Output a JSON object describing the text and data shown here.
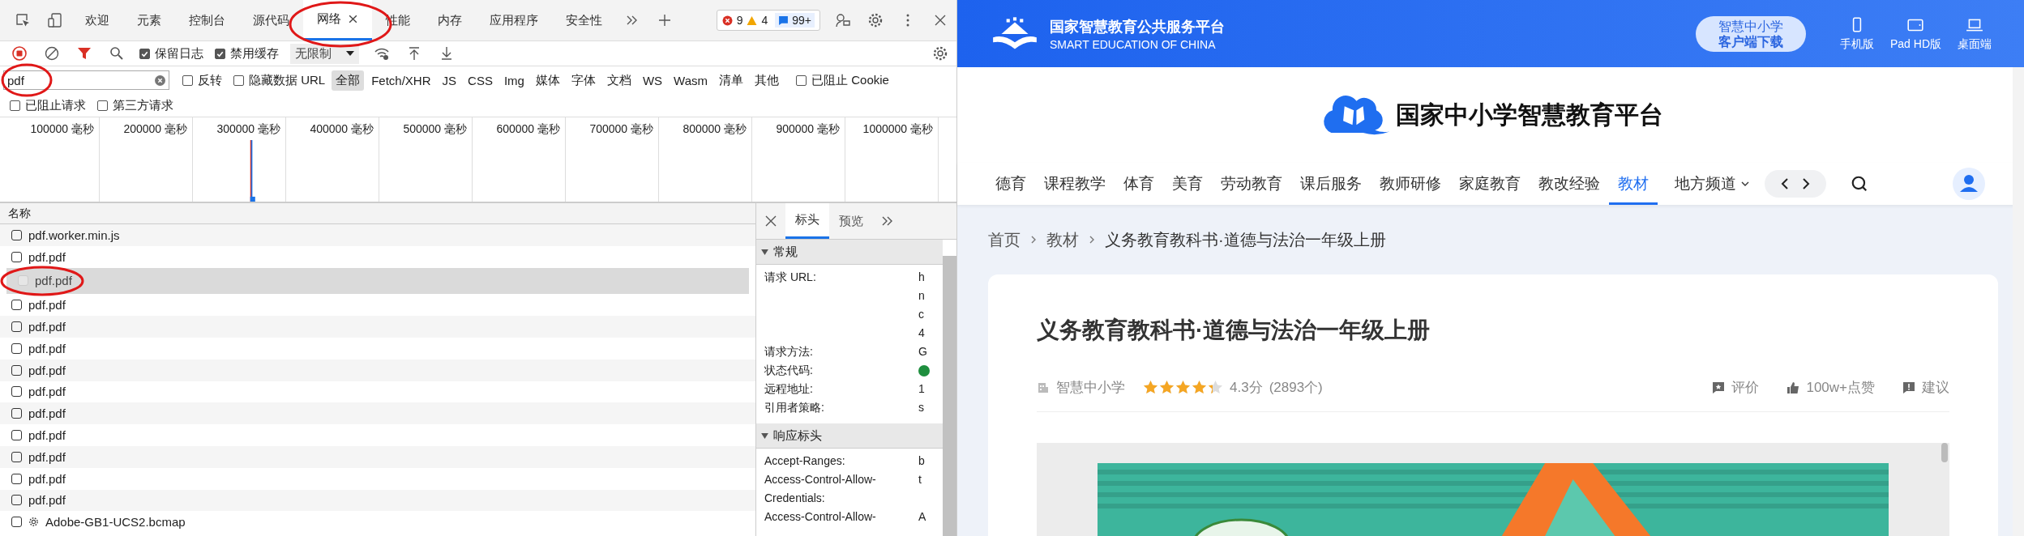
{
  "devtools": {
    "tabs": [
      {
        "label": "欢迎",
        "selected": false,
        "closable": false
      },
      {
        "label": "元素",
        "selected": false,
        "closable": false
      },
      {
        "label": "控制台",
        "selected": false,
        "closable": false
      },
      {
        "label": "源代码",
        "selected": false,
        "closable": false
      },
      {
        "label": "网络",
        "selected": true,
        "closable": true
      },
      {
        "label": "性能",
        "selected": false,
        "closable": false
      },
      {
        "label": "内存",
        "selected": false,
        "closable": false
      },
      {
        "label": "应用程序",
        "selected": false,
        "closable": false
      },
      {
        "label": "安全性",
        "selected": false,
        "closable": false
      }
    ],
    "issues": {
      "errors": "9",
      "warnings": "4",
      "messages": "99+"
    },
    "toolbar": {
      "preserve_log": {
        "label": "保留日志",
        "checked": true
      },
      "disable_cache": {
        "label": "禁用缓存",
        "checked": true
      },
      "throttling": "无限制"
    },
    "filter": {
      "value": "pdf",
      "options": [
        {
          "label": "反转",
          "checked": false
        },
        {
          "label": "隐藏数据 URL",
          "checked": false
        }
      ],
      "types": [
        {
          "label": "全部",
          "selected": true
        },
        {
          "label": "Fetch/XHR",
          "selected": false
        },
        {
          "label": "JS",
          "selected": false
        },
        {
          "label": "CSS",
          "selected": false
        },
        {
          "label": "Img",
          "selected": false
        },
        {
          "label": "媒体",
          "selected": false
        },
        {
          "label": "字体",
          "selected": false
        },
        {
          "label": "文档",
          "selected": false
        },
        {
          "label": "WS",
          "selected": false
        },
        {
          "label": "Wasm",
          "selected": false
        },
        {
          "label": "清单",
          "selected": false
        },
        {
          "label": "其他",
          "selected": false
        }
      ],
      "more_options": [
        {
          "label": "已阻止 Cookie",
          "checked": false
        }
      ],
      "second_row": [
        {
          "label": "已阻止请求",
          "checked": false
        },
        {
          "label": "第三方请求",
          "checked": false
        }
      ]
    },
    "timeline": {
      "ticks": [
        "100000 毫秒",
        "200000 毫秒",
        "300000 毫秒",
        "400000 毫秒",
        "500000 毫秒",
        "600000 毫秒",
        "700000 毫秒",
        "800000 毫秒",
        "900000 毫秒",
        "1000000 毫秒"
      ]
    },
    "requests": {
      "column": "名称",
      "rows": [
        {
          "name": "pdf.worker.min.js",
          "kind": "plain",
          "selected": false
        },
        {
          "name": "pdf.pdf",
          "kind": "plain",
          "selected": false
        },
        {
          "name": "pdf.pdf",
          "kind": "plain",
          "selected": true
        },
        {
          "name": "pdf.pdf",
          "kind": "plain",
          "selected": false
        },
        {
          "name": "pdf.pdf",
          "kind": "plain",
          "selected": false
        },
        {
          "name": "pdf.pdf",
          "kind": "plain",
          "selected": false
        },
        {
          "name": "pdf.pdf",
          "kind": "plain",
          "selected": false
        },
        {
          "name": "pdf.pdf",
          "kind": "plain",
          "selected": false
        },
        {
          "name": "pdf.pdf",
          "kind": "plain",
          "selected": false
        },
        {
          "name": "pdf.pdf",
          "kind": "plain",
          "selected": false
        },
        {
          "name": "pdf.pdf",
          "kind": "plain",
          "selected": false
        },
        {
          "name": "pdf.pdf",
          "kind": "plain",
          "selected": false
        },
        {
          "name": "pdf.pdf",
          "kind": "plain",
          "selected": false
        },
        {
          "name": "Adobe-GB1-UCS2.bcmap",
          "kind": "gear",
          "selected": false
        }
      ]
    },
    "details": {
      "tabs": [
        {
          "label": "标头",
          "selected": true
        },
        {
          "label": "预览",
          "selected": false
        }
      ],
      "sections": [
        {
          "title": "常规",
          "expanded": true,
          "rows": [
            {
              "kind": "text",
              "key": "请求 URL:",
              "value": "h"
            },
            {
              "kind": "text",
              "value": "n"
            },
            {
              "kind": "text",
              "value": "c"
            },
            {
              "kind": "text",
              "value": "4"
            },
            {
              "kind": "text",
              "key": "请求方法:",
              "value": "G"
            },
            {
              "kind": "status",
              "key": "状态代码:",
              "color": "#1e8e3e"
            },
            {
              "kind": "text",
              "key": "远程地址:",
              "value": "1"
            },
            {
              "kind": "text",
              "key": "引用者策略:",
              "value": "s"
            }
          ]
        },
        {
          "title": "响应标头",
          "expanded": true,
          "rows": [
            {
              "kind": "text",
              "key": "Accept-Ranges:",
              "value": "b"
            },
            {
              "kind": "text",
              "key": "Access-Control-Allow-Credentials:",
              "value": "t"
            },
            {
              "kind": "text",
              "key": "Access-Control-Allow-",
              "value": "A"
            }
          ]
        }
      ]
    }
  },
  "page": {
    "header": {
      "title": "国家智慧教育公共服务平台",
      "subtitle": "SMART EDUCATION OF CHINA",
      "download": [
        "智慧中小学",
        "客户端下载"
      ],
      "devices": [
        {
          "kind": "phone",
          "label": "手机版"
        },
        {
          "kind": "tablet",
          "label": "Pad HD版"
        },
        {
          "kind": "desktop",
          "label": "桌面端"
        }
      ]
    },
    "brand": "国家中小学智慧教育平台",
    "nav": [
      {
        "label": "德育",
        "selected": false,
        "kind": "link"
      },
      {
        "label": "课程教学",
        "selected": false,
        "kind": "link"
      },
      {
        "label": "体育",
        "selected": false,
        "kind": "link"
      },
      {
        "label": "美育",
        "selected": false,
        "kind": "link"
      },
      {
        "label": "劳动教育",
        "selected": false,
        "kind": "link"
      },
      {
        "label": "课后服务",
        "selected": false,
        "kind": "link"
      },
      {
        "label": "教师研修",
        "selected": false,
        "kind": "link"
      },
      {
        "label": "家庭教育",
        "selected": false,
        "kind": "link"
      },
      {
        "label": "教改经验",
        "selected": false,
        "kind": "link"
      },
      {
        "label": "教材",
        "selected": true,
        "kind": "link"
      },
      {
        "label": "地方频道",
        "selected": false,
        "kind": "dropdown"
      }
    ],
    "breadcrumb": [
      "首页",
      "教材",
      "义务教育教科书·道德与法治一年级上册"
    ],
    "card": {
      "title": "义务教育教科书·道德与法治一年级上册",
      "publisher": "智慧中小学",
      "stars": 4.3,
      "score": "4.3分",
      "count": "(2893个)",
      "actions": [
        {
          "kind": "comment",
          "label": "评价"
        },
        {
          "kind": "like",
          "label": "100w+点赞"
        },
        {
          "kind": "report",
          "label": "建议"
        }
      ]
    }
  }
}
